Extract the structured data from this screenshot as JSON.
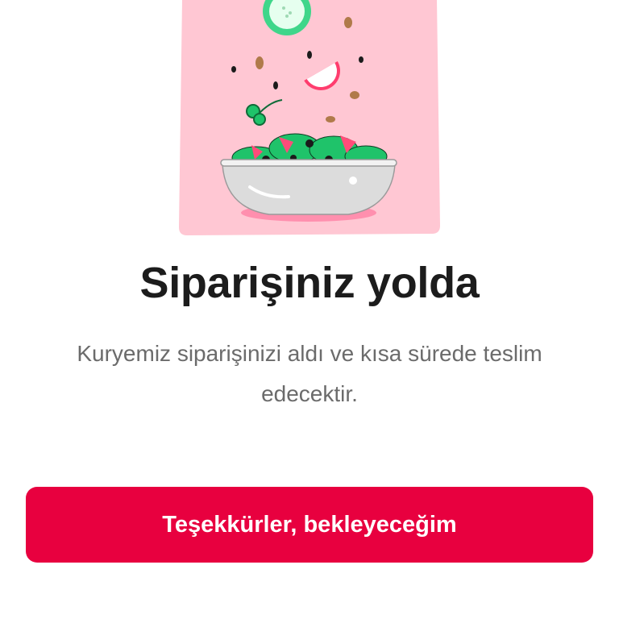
{
  "screen": {
    "title": "Siparişiniz yolda",
    "message": "Kuryemiz siparişinizi aldı ve kısa sürede teslim edecektir.",
    "confirm_button_label": "Teşekkürler, bekleyeceğim"
  },
  "illustration": {
    "icon": "salad-bowl-icon"
  },
  "colors": {
    "accent": "#e8003f",
    "illustration_background": "#ffc7d3",
    "title_text": "#1c1c1c",
    "body_text": "#6b6b6b"
  }
}
